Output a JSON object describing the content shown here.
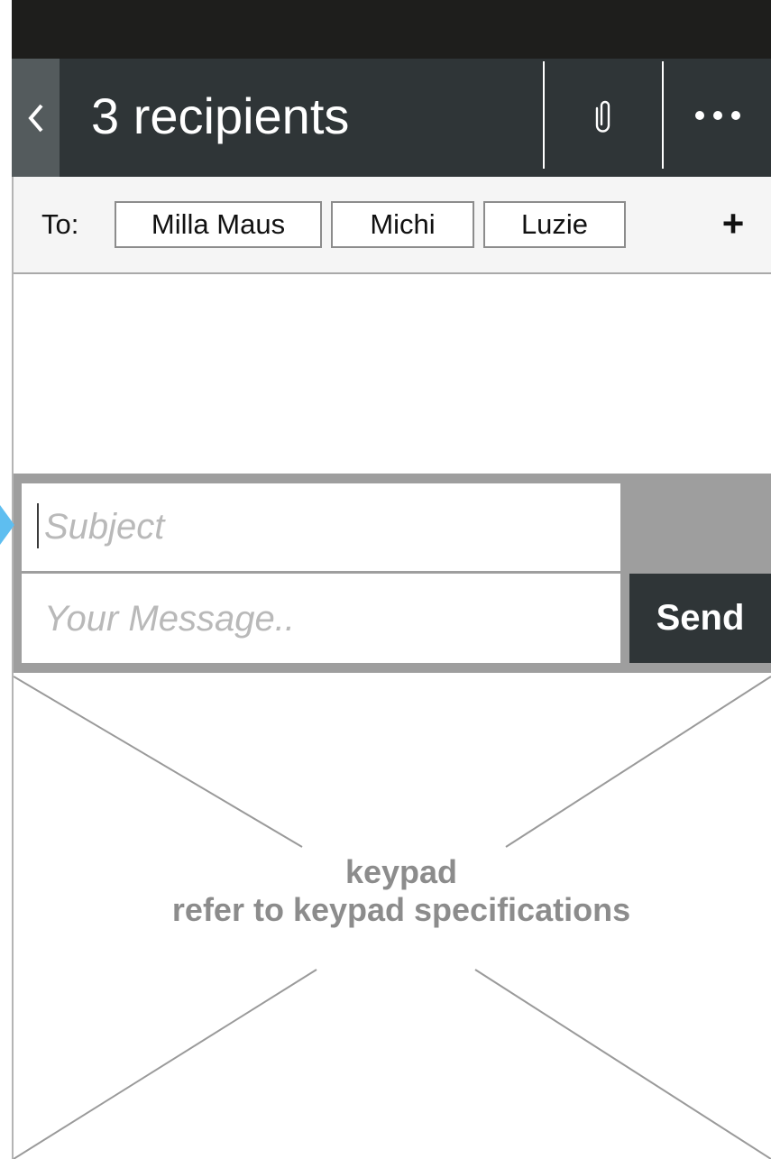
{
  "header": {
    "title": "3 recipients",
    "back_icon": "chevron-left-icon",
    "attach_icon": "paperclip-icon",
    "more_icon": "more-horizontal-icon"
  },
  "recipients": {
    "label": "To:",
    "chips": [
      "Milla Maus",
      "Michi",
      "Luzie"
    ],
    "add_label": "+"
  },
  "compose": {
    "subject_placeholder": "Subject",
    "message_placeholder": "Your Message..",
    "send_label": "Send"
  },
  "keypad": {
    "title": "keypad",
    "subtitle": "refer to keypad specifications"
  },
  "colors": {
    "header_bg": "#2f3537",
    "status_bg": "#1e1e1c",
    "send_bg": "#2f3537",
    "focus_marker": "#5ebef0"
  }
}
